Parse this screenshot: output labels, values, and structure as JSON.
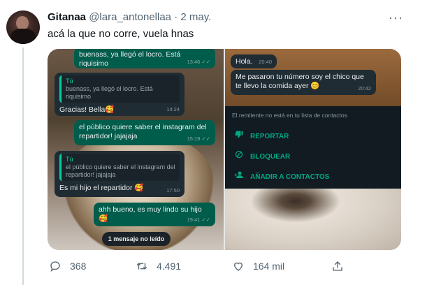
{
  "author": {
    "name": "Gitanaa",
    "handle": "@lara_antonellaa",
    "separator": "·",
    "date": "2 may."
  },
  "tweet": {
    "text": "acá la que no corre, vuela hnas"
  },
  "chat_left": {
    "bubbles": [
      {
        "text": "buenass, ya llegó el locro. Está riquisimo",
        "time": "13:46 ✓✓"
      },
      {
        "quote_author": "Tú",
        "quote_text": "buenass, ya llegó el locro. Está riquisimo",
        "text": "Gracias! Bella🥰",
        "time": "14:24"
      },
      {
        "text": "el público quiere saber el instagram del repartidor! jajajaja",
        "time": "15:19 ✓✓"
      },
      {
        "quote_author": "Tú",
        "quote_text": "el público quiere saber el instagram del repartidor! jajajaja",
        "text": "Es mi hijo el repartidor 🥰",
        "time": "17:50"
      },
      {
        "text": "ahh bueno, es muy lindo su hijo🥰",
        "time": "19:41 ✓✓"
      }
    ],
    "unread_label": "1 mensaje no leído"
  },
  "chat_right": {
    "bubbles": [
      {
        "text": "Hola.",
        "time": "20:40"
      },
      {
        "text": "Me pasaron tu número soy el chico que te llevo la comida ayer 😊",
        "time": "20:42"
      }
    ],
    "notice": "El remitente no está en tu lista de contactos",
    "actions": [
      {
        "icon": "thumbs-down-icon",
        "label": "REPORTAR"
      },
      {
        "icon": "block-icon",
        "label": "BLOQUEAR"
      },
      {
        "icon": "add-contact-icon",
        "label": "AÑADIR A CONTACTOS"
      }
    ]
  },
  "stats": {
    "replies": "368",
    "retweets": "4.491",
    "likes": "164 mil"
  },
  "colors": {
    "bubble_out": "#005c4b",
    "bubble_in": "#202c33",
    "whatsapp_accent": "#00a884",
    "twitter_gray": "#536471"
  }
}
